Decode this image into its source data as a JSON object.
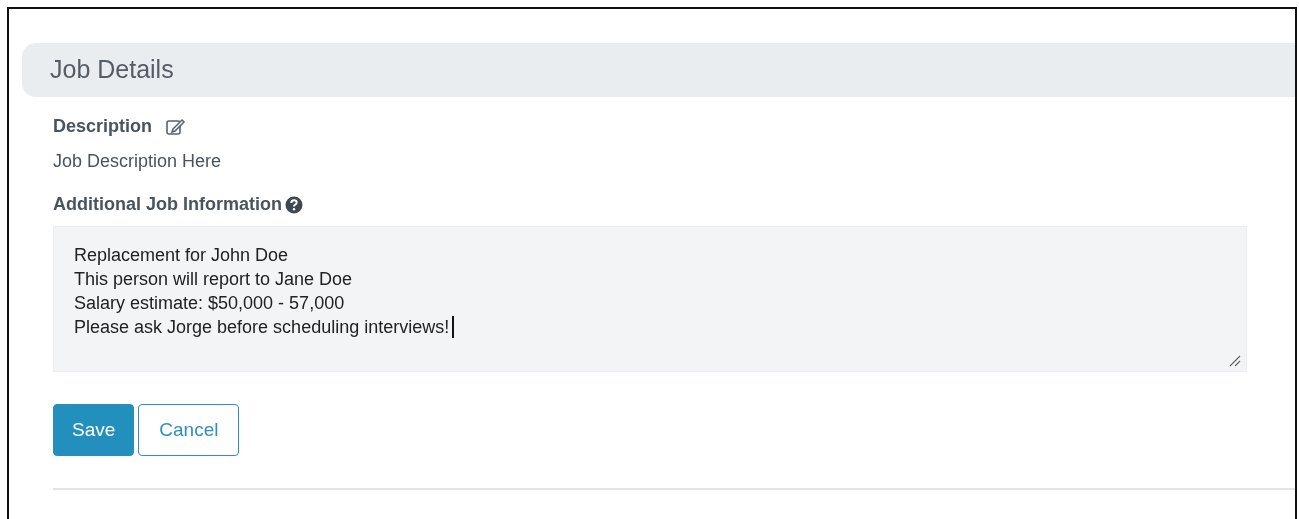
{
  "section": {
    "title": "Job Details"
  },
  "description": {
    "label": "Description",
    "value": "Job Description Here"
  },
  "additional_info": {
    "label": "Additional Job Information",
    "lines": [
      "Replacement for John Doe",
      "This person will report to Jane Doe",
      "Salary estimate: $50,000 - 57,000",
      "Please ask Jorge before scheduling interviews!"
    ],
    "focused": true
  },
  "buttons": [
    {
      "label": "Save",
      "kind": "primary"
    },
    {
      "label": "Cancel",
      "kind": "outline"
    }
  ]
}
